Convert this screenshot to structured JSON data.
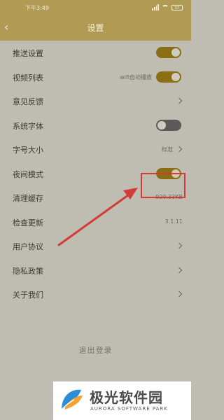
{
  "statusbar": {
    "time": "下午3:49",
    "battery": "57"
  },
  "navbar": {
    "back_icon": "chevron-left-icon",
    "title": "设置"
  },
  "settings": [
    {
      "label": "推送设置",
      "control": "toggle",
      "state": "on"
    },
    {
      "label": "视频列表",
      "control": "toggle",
      "state": "on",
      "value": "wifi自动播放"
    },
    {
      "label": "意见反馈",
      "control": "chevron"
    },
    {
      "label": "系统字体",
      "control": "toggle",
      "state": "off"
    },
    {
      "label": "字号大小",
      "control": "chevron",
      "value": "标准"
    },
    {
      "label": "夜间模式",
      "control": "toggle",
      "state": "on"
    },
    {
      "label": "清理缓存",
      "control": "value",
      "value": "920.33KB"
    },
    {
      "label": "检查更新",
      "control": "value",
      "value": "3.1.11"
    },
    {
      "label": "用户协议",
      "control": "chevron"
    },
    {
      "label": "隐私政策",
      "control": "chevron"
    },
    {
      "label": "关于我们",
      "control": "chevron"
    }
  ],
  "logout_label": "退出登录",
  "watermark": {
    "title": "极光软件园",
    "subtitle": "AURORA SOFTWARE PARK"
  },
  "colors": {
    "header": "#b09a54",
    "toggle_on": "#8a6f12",
    "toggle_off": "#5c5a58",
    "highlight": "#d43a37"
  }
}
